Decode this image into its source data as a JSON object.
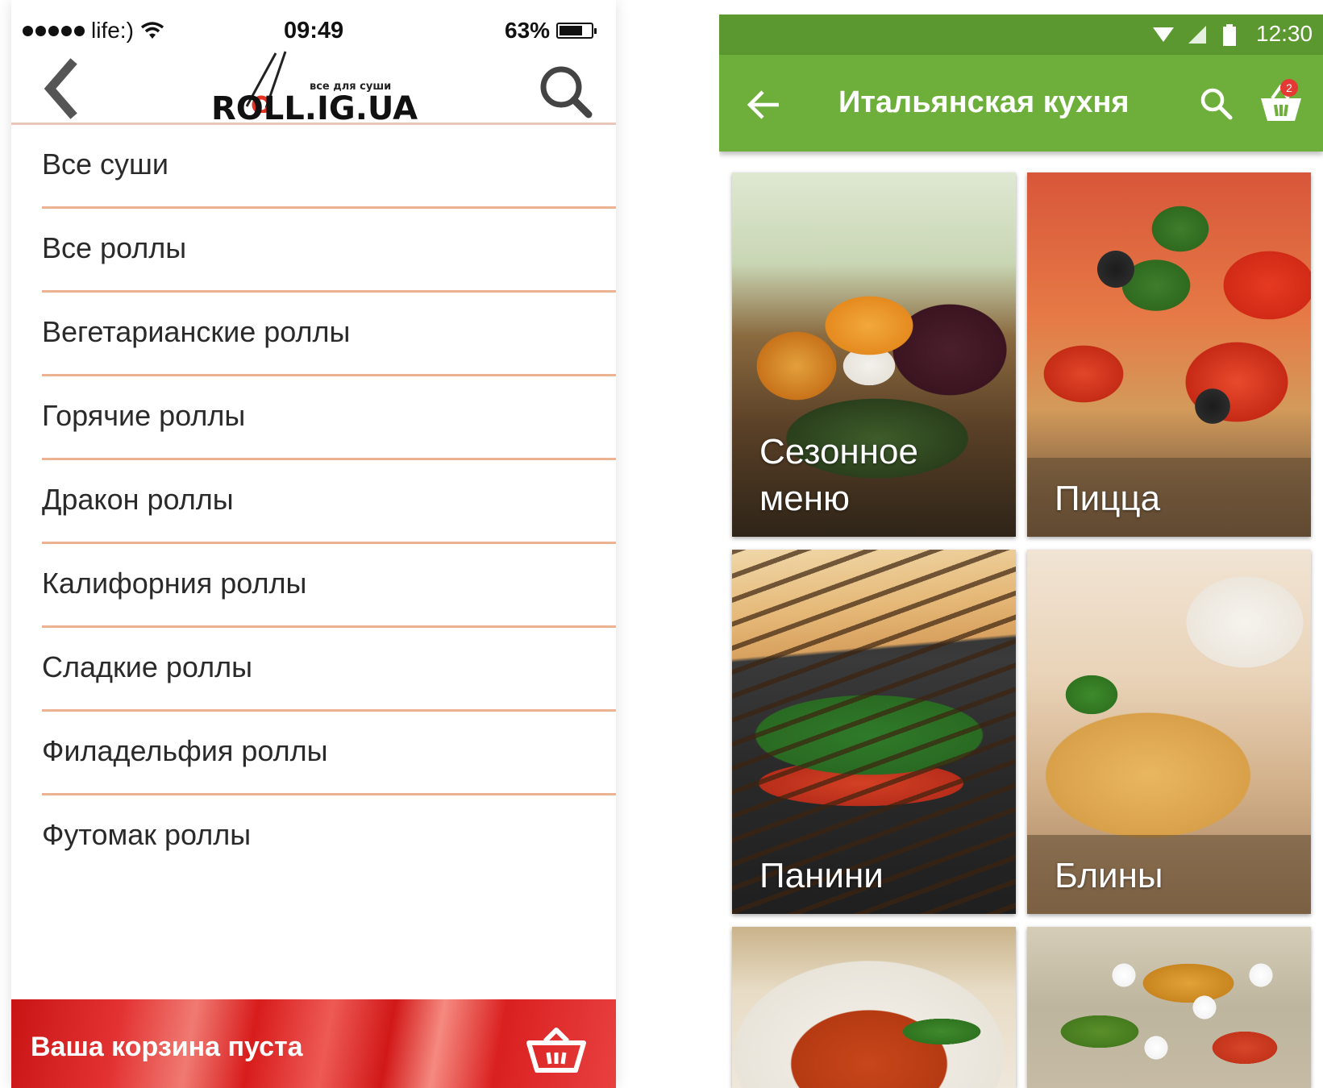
{
  "left_app": {
    "status_bar": {
      "carrier": "life:)",
      "time": "09:49",
      "battery": "63%"
    },
    "header": {
      "logo_text": "ROLL.IG.UA",
      "logo_subtitle": "все для суши",
      "back_icon": "chevron-left-icon",
      "search_icon": "search-icon"
    },
    "categories": [
      {
        "label": "Все суши"
      },
      {
        "label": "Все роллы"
      },
      {
        "label": "Вегетарианские роллы"
      },
      {
        "label": "Горячие роллы"
      },
      {
        "label": "Дракон роллы"
      },
      {
        "label": "Калифорния роллы"
      },
      {
        "label": "Сладкие роллы"
      },
      {
        "label": "Филадельфия роллы"
      },
      {
        "label": "Футомак роллы"
      }
    ],
    "cart_bar": {
      "label": "Ваша корзина пуста",
      "icon": "basket-icon"
    },
    "colors": {
      "accent": "#e3262a",
      "separator": "#ecb292"
    }
  },
  "right_app": {
    "status_bar": {
      "time": "12:30"
    },
    "toolbar": {
      "title": "Итальянская кухня",
      "back_icon": "arrow-left-icon",
      "search_icon": "search-icon",
      "cart_icon": "cart-icon",
      "cart_badge": "2"
    },
    "tiles": [
      {
        "caption_line1": "Сезонное",
        "caption_line2": "меню"
      },
      {
        "caption_line1": "Пицца"
      },
      {
        "caption_line1": "Панини"
      },
      {
        "caption_line1": "Блины"
      },
      {
        "caption_line1": ""
      },
      {
        "caption_line1": ""
      }
    ],
    "colors": {
      "status_bar": "#5b982f",
      "toolbar": "#6eaf3c"
    }
  }
}
